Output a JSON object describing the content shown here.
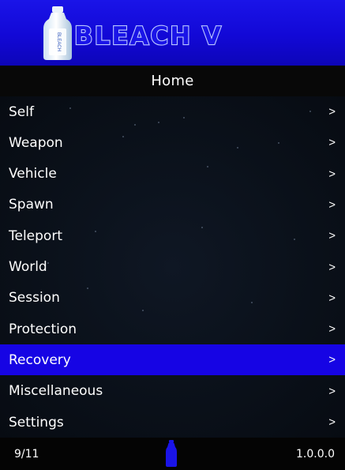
{
  "banner": {
    "brand": "BLEACH V",
    "bottle_label": "BLEACH"
  },
  "header": {
    "title": "Home"
  },
  "menu": {
    "items": [
      {
        "label": "Self",
        "arrow": ">"
      },
      {
        "label": "Weapon",
        "arrow": ">"
      },
      {
        "label": "Vehicle",
        "arrow": ">"
      },
      {
        "label": "Spawn",
        "arrow": ">"
      },
      {
        "label": "Teleport",
        "arrow": ">"
      },
      {
        "label": "World",
        "arrow": ">"
      },
      {
        "label": "Session",
        "arrow": ">"
      },
      {
        "label": "Protection",
        "arrow": ">"
      },
      {
        "label": "Recovery",
        "arrow": ">"
      },
      {
        "label": "Miscellaneous",
        "arrow": ">"
      },
      {
        "label": "Settings",
        "arrow": ">"
      }
    ],
    "selected_index": 8
  },
  "footer": {
    "position": "9/11",
    "version": "1.0.0.0"
  },
  "colors": {
    "banner": "#1a14e8",
    "selected": "#1604e4",
    "background": "#05070c"
  },
  "icons": {
    "logo": "bleach-bottle-icon",
    "footer": "bottle-icon"
  }
}
